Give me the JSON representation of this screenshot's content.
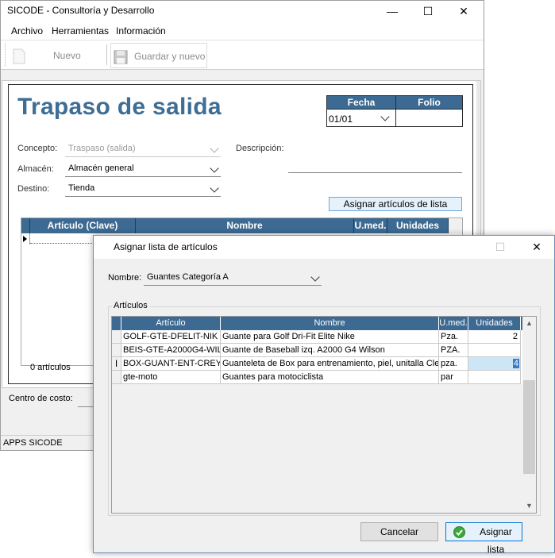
{
  "window": {
    "title": "SICODE - Consultoría y Desarrollo",
    "minimize": "—",
    "maximize": "☐",
    "close": "✕"
  },
  "menu": [
    "Archivo",
    "Herramientas",
    "Información"
  ],
  "toolbar": {
    "new_label": "Nuevo",
    "save_new_label": "Guardar y nuevo"
  },
  "form": {
    "title": "Trapaso de salida",
    "fecha_header": "Fecha",
    "folio_header": "Folio",
    "fecha_value": "01/01",
    "folio_value": "",
    "concepto_label": "Concepto:",
    "concepto_value": "Traspaso (salida)",
    "almacen_label": "Almacén:",
    "almacen_value": "Almacén general",
    "destino_label": "Destino:",
    "destino_value": "Tienda",
    "descripcion_label": "Descripción:",
    "assign_button": "Asignar artículos de lista",
    "grid_columns": [
      "Artículo (Clave)",
      "Nombre",
      "U.med.",
      "Unidades"
    ],
    "articles_count": "0 artículos",
    "centro_costo_label": "Centro de costo:"
  },
  "statusbar": {
    "text": "APPS SICODE"
  },
  "dialog": {
    "title": "Asignar lista de artículos",
    "nombre_label": "Nombre:",
    "nombre_value": "Guantes Categoría A",
    "group_label": "Artículos",
    "columns": [
      "Artículo",
      "Nombre",
      "U.med.",
      "Unidades"
    ],
    "rows": [
      {
        "articulo": "GOLF-GTE-DFELIT-NIK",
        "nombre": "Guante para Golf Dri-Fit Elite Nike",
        "umed": "Pza.",
        "unidades": "2"
      },
      {
        "articulo": "BEIS-GTE-A2000G4-WIL",
        "nombre": "Guante de Baseball izq. A2000 G4 Wilson",
        "umed": "PZA.",
        "unidades": ""
      },
      {
        "articulo": "BOX-GUANT-ENT-CREY",
        "nombre": "Guanteleta de Box para entrenamiento, piel, unitalla Clet",
        "umed": "pza.",
        "unidades": "4"
      },
      {
        "articulo": "gte-moto",
        "nombre": "Guantes para motociclista",
        "umed": "par",
        "unidades": ""
      }
    ],
    "cancel_button": "Cancelar",
    "assign_button": "Asignar lista"
  },
  "colors": {
    "header_blue": "#3c6a92",
    "title_blue": "#3e6e95",
    "selection_blue": "#cde6f7"
  }
}
